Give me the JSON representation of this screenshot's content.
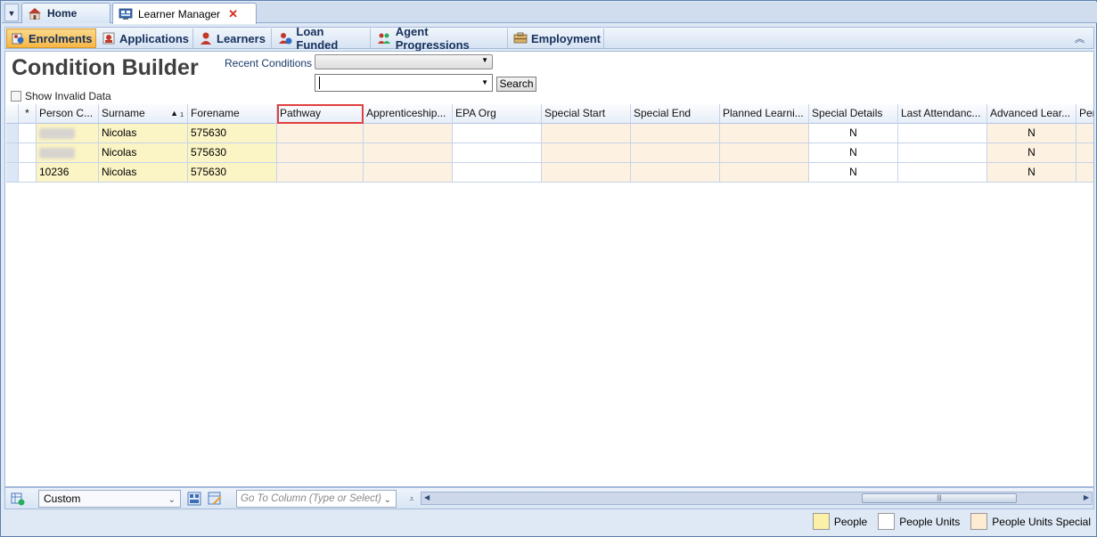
{
  "doc_tabs": {
    "home": "Home",
    "learner_manager": "Learner Manager"
  },
  "modules": [
    {
      "label": "Enrolments",
      "icon": "enrolments-icon",
      "active": true
    },
    {
      "label": "Applications",
      "icon": "applications-icon",
      "active": false
    },
    {
      "label": "Learners",
      "icon": "learners-icon",
      "active": false
    },
    {
      "label": "Loan Funded",
      "icon": "loan-funded-icon",
      "active": false
    },
    {
      "label": "Agent Progressions",
      "icon": "agent-progressions-icon",
      "active": false
    },
    {
      "label": "Employment",
      "icon": "employment-icon",
      "active": false
    }
  ],
  "condition_builder": {
    "title": "Condition Builder",
    "recent_label": "Recent Conditions",
    "recent_value": "",
    "condition_value": "",
    "search_label": "Search",
    "show_invalid_label": "Show Invalid Data",
    "show_invalid_checked": false
  },
  "grid": {
    "columns": [
      "*",
      "Person C...",
      "Surname",
      "Forename",
      "Pathway",
      "Apprenticeship...",
      "EPA Org",
      "Special Start",
      "Special End",
      "Planned Learni...",
      "Special Details",
      "Last Attendanc...",
      "Advanced Lear...",
      "Per"
    ],
    "sort": {
      "column": "Surname",
      "direction": "ascending",
      "index": "1"
    },
    "highlighted_column": "Pathway",
    "rows": [
      {
        "person_code": "",
        "surname": "Nicolas",
        "forename": "575630",
        "pathway": "",
        "apprenticeship": "",
        "epa_org": "",
        "special_start": "",
        "special_end": "",
        "planned_learning": "",
        "special_details": "N",
        "last_attendance": "",
        "advanced_learner": "N"
      },
      {
        "person_code": "",
        "surname": "Nicolas",
        "forename": "575630",
        "pathway": "",
        "apprenticeship": "",
        "epa_org": "",
        "special_start": "",
        "special_end": "",
        "planned_learning": "",
        "special_details": "N",
        "last_attendance": "",
        "advanced_learner": "N"
      },
      {
        "person_code": "10236",
        "surname": "Nicolas",
        "forename": "575630",
        "pathway": "",
        "apprenticeship": "",
        "epa_org": "",
        "special_start": "",
        "special_end": "",
        "planned_learning": "",
        "special_details": "N",
        "last_attendance": "",
        "advanced_learner": "N"
      }
    ]
  },
  "bottom_toolbar": {
    "layout_value": "Custom",
    "goto_placeholder": "Go To Column (Type or Select)"
  },
  "legend": [
    {
      "label": "People",
      "color": "#fbf0a8"
    },
    {
      "label": "People Units",
      "color": "#ffffff"
    },
    {
      "label": "People Units Special",
      "color": "#fdebd2"
    }
  ],
  "colors": {
    "active_tab": "#f6b745",
    "highlight_border": "#e04040",
    "people": "#fbf4c5",
    "people_units_special": "#fdf1e1"
  }
}
